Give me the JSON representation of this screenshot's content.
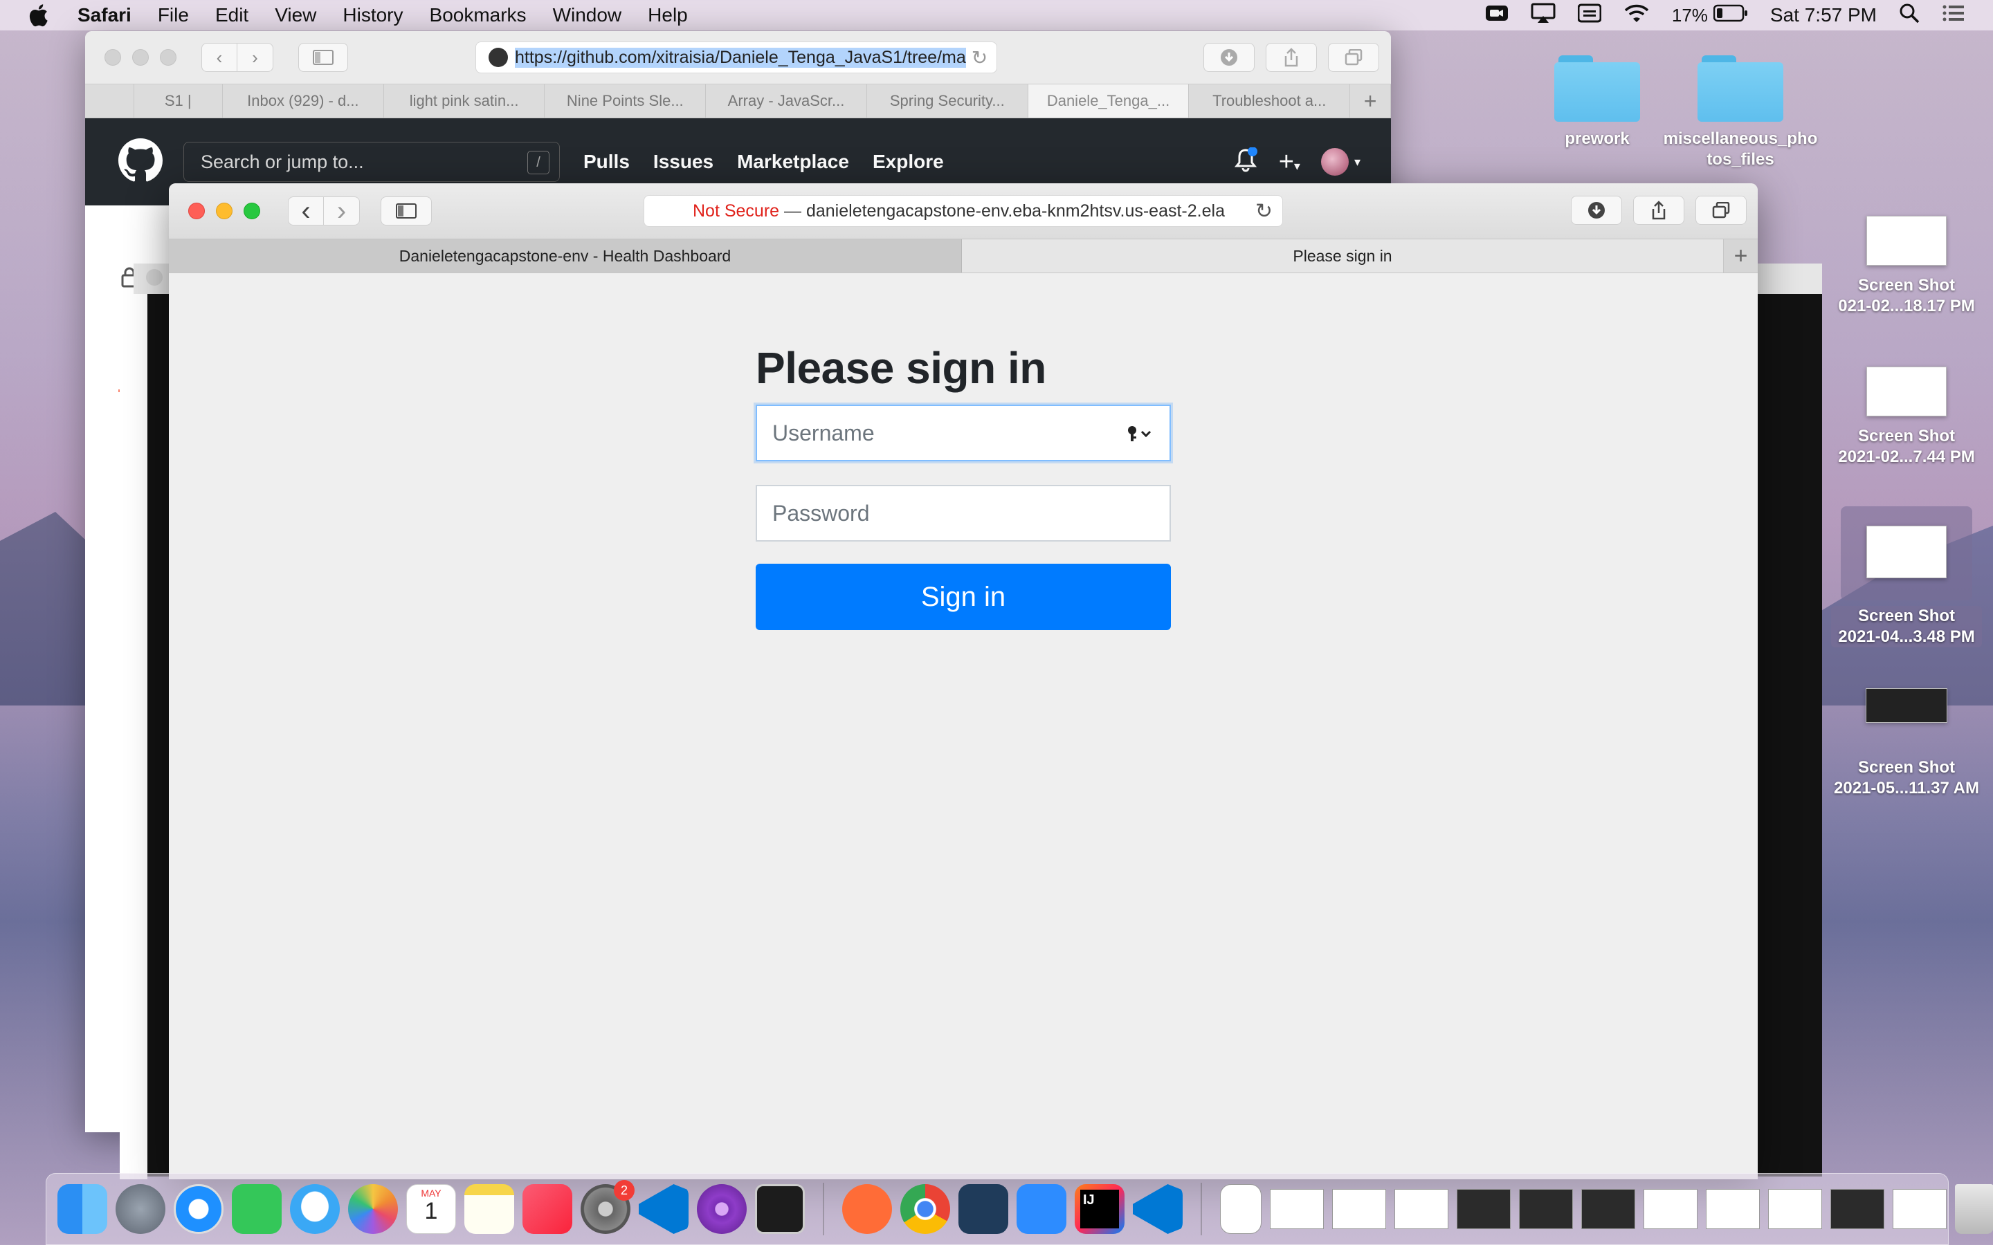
{
  "menubar": {
    "app": "Safari",
    "items": [
      "File",
      "Edit",
      "View",
      "History",
      "Bookmarks",
      "Window",
      "Help"
    ],
    "battery": "17%",
    "clock": "Sat 7:57 PM"
  },
  "desktop": {
    "folders": [
      {
        "label": "prework"
      },
      {
        "label": "miscellaneous_pho tos_files"
      }
    ],
    "screenshots": [
      {
        "label1": "Screen Shot",
        "label2": "021-02...18.17 PM"
      },
      {
        "label1": "Screen Shot",
        "label2": "2021-02...7.44 PM"
      },
      {
        "label1": "Screen Shot",
        "label2": "2021-04...3.48 PM"
      },
      {
        "label1": "Screen Shot",
        "label2": "2021-05...11.37 AM"
      }
    ]
  },
  "github_window": {
    "url": "https://github.com/xitraisia/Daniele_Tenga_JavaS1/tree/ma",
    "tabs": [
      "S1 |",
      "Inbox (929) - d...",
      "light pink satin...",
      "Nine Points Sle...",
      "Array - JavaScr...",
      "Spring Security...",
      "Daniele_Tenga_...",
      "Troubleshoot a..."
    ],
    "search_placeholder": "Search or jump to...",
    "search_key": "/",
    "nav": [
      "Pulls",
      "Issues",
      "Marketplace",
      "Explore"
    ],
    "repo_fragment": "xi"
  },
  "front_window": {
    "url_prefix": "Not Secure",
    "url_sep": " — ",
    "url": "danieletengacapstone-env.eba-knm2htsv.us-east-2.ela",
    "tabs": [
      "Danieletengacapstone-env - Health Dashboard",
      "Please sign in"
    ],
    "new_tab": "+"
  },
  "signin": {
    "heading": "Please sign in",
    "username_placeholder": "Username",
    "password_placeholder": "Password",
    "submit_label": "Sign in"
  },
  "dock": {
    "badge_count": "2",
    "calendar_month": "MAY",
    "calendar_day": "1",
    "intellij_label": "IJ"
  },
  "colors": {
    "primary": "#007bff",
    "github_header": "#24292e",
    "not_secure": "#e0221b"
  }
}
